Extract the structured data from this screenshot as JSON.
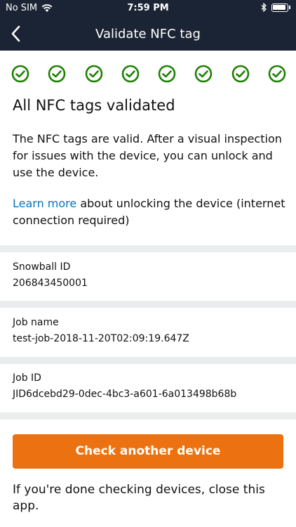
{
  "status_bar": {
    "carrier": "No SIM",
    "time": "7:59 PM"
  },
  "nav": {
    "title": "Validate NFC tag"
  },
  "check_icons": [
    "check-circle-icon",
    "check-circle-icon",
    "check-circle-icon",
    "check-circle-icon",
    "check-circle-icon",
    "check-circle-icon",
    "check-circle-icon",
    "check-circle-icon"
  ],
  "colors": {
    "nav_background": "#1b2434",
    "check_green": "#1d8102",
    "link_blue": "#0873b9",
    "button_orange": "#ec7211",
    "divider_gray": "#eaeded"
  },
  "content": {
    "headline": "All NFC tags validated",
    "description": "The NFC tags are valid. After a visual inspection for issues with the device, you can unlock and use the device.",
    "learn_more_link": "Learn more",
    "learn_more_rest": " about unlocking the device (internet connection required)"
  },
  "fields": {
    "snowball_id": {
      "label": "Snowball ID",
      "value": "206843450001"
    },
    "job_name": {
      "label": "Job name",
      "value": "test-job-2018-11-20T02:09:19.647Z"
    },
    "job_id": {
      "label": "Job ID",
      "value": "JID6dcebd29-0dec-4bc3-a601-6a013498b68b"
    }
  },
  "actions": {
    "check_another_label": "Check another device"
  },
  "footer": {
    "text": "If you're done checking devices, close this app."
  }
}
